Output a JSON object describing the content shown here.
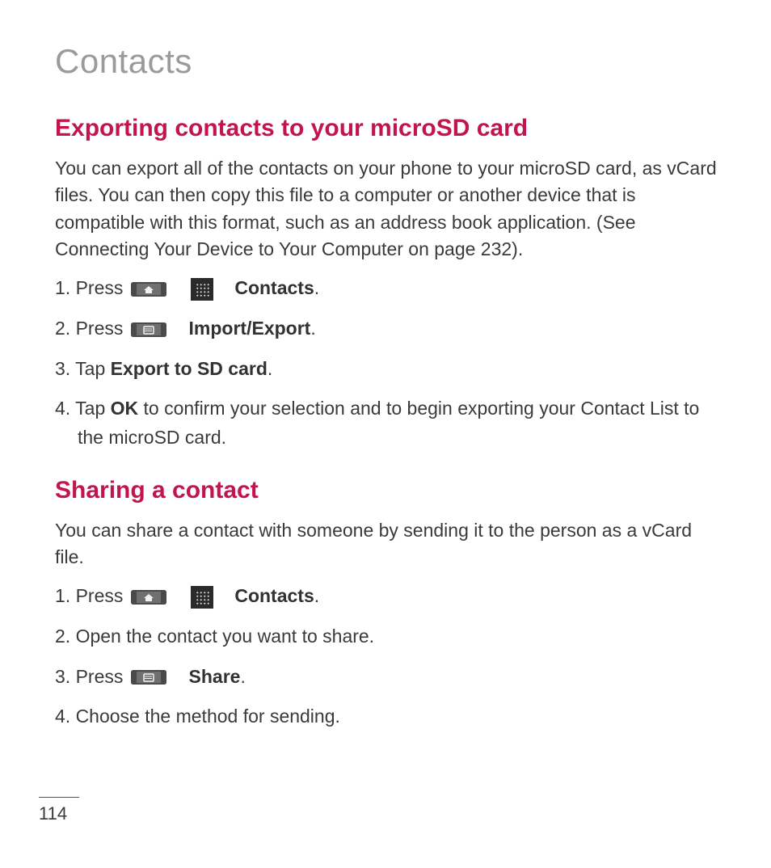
{
  "page_title": "Contacts",
  "section1": {
    "heading": "Exporting contacts to your microSD card",
    "intro": "You can export all of the contacts on your phone to your microSD card, as vCard files. You can then copy this file to a computer or another device that is compatible with this format, such as an address book application. (See Connecting Your Device to Your Computer on page 232).",
    "steps": {
      "s1": {
        "prefix": "1. Press ",
        "sep": ">",
        "contacts": "Contacts",
        "suffix": "."
      },
      "s2": {
        "prefix": "2. Press ",
        "sep": ">",
        "importexport": "Import/Export",
        "suffix": "."
      },
      "s3": {
        "prefix": "3. Tap ",
        "bold": "Export to SD card",
        "suffix": "."
      },
      "s4": {
        "prefix": "4. Tap ",
        "bold": "OK",
        "rest": " to confirm your selection and to begin exporting your Contact List to the microSD card."
      }
    }
  },
  "section2": {
    "heading": "Sharing a contact",
    "intro": "You can share a contact with someone by sending it to the person as a vCard file.",
    "steps": {
      "s1": {
        "prefix": "1. Press ",
        "sep": ">",
        "contacts": "Contacts",
        "suffix": "."
      },
      "s2": {
        "text": "2. Open the contact you want to share."
      },
      "s3": {
        "prefix": "3. Press ",
        "sep": ">",
        "share": "Share",
        "suffix": "."
      },
      "s4": {
        "text": "4. Choose the method for sending."
      }
    }
  },
  "page_number": "114"
}
